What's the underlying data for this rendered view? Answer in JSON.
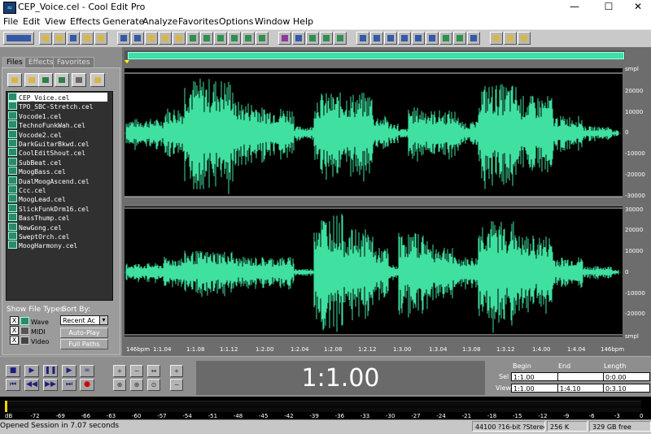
{
  "window": {
    "title": "CEP_Voice.cel - Cool Edit Pro",
    "minimize_glyph": "—",
    "maximize_glyph": "☐",
    "close_glyph": "✕"
  },
  "menu": [
    "File",
    "Edit",
    "View",
    "Effects",
    "Generate",
    "Analyze",
    "Favorites",
    "Options",
    "Window",
    "Help"
  ],
  "panel": {
    "tabs": [
      "Files",
      "Effects",
      "Favorites"
    ],
    "files": [
      "CEP_Voice.cel",
      "TPO_SBC-Stretch.cel",
      "Vocode1.cel",
      "TechnoFunkWah.cel",
      "Vocode2.cel",
      "DarkGuitarBkwd.cel",
      "CoolEditShout.cel",
      "SubBeat.cel",
      "MoogBass.cel",
      "DualMoogAscend.cel",
      "Ccc.cel",
      "MoogLead.cel",
      "SlickFunkDrm16.cel",
      "BassThump.cel",
      "NewGong.cel",
      "SweptOrch.cel",
      "MoogHarmony.cel"
    ],
    "selected_index": 0,
    "show_file_types_label": "Show File Types:",
    "sort_by_label": "Sort By:",
    "file_types": [
      {
        "label": "Wave",
        "checked": true
      },
      {
        "label": "MIDI",
        "checked": true
      },
      {
        "label": "Video",
        "checked": true
      }
    ],
    "check_glyph": "X",
    "sort_value": "Recent Ac",
    "dropdown_glyph": "▾",
    "auto_play_label": "Auto-Play",
    "full_paths_label": "Full Paths"
  },
  "waveform": {
    "ruler_unit": "smpl",
    "ch1_labels": [
      "20000",
      "10000",
      "0",
      "-10000",
      "-20000",
      "-30000"
    ],
    "ch2_labels": [
      "30000",
      "20000",
      "10000",
      "0",
      "-10000",
      "-20000"
    ],
    "time_labels": [
      "146bpm",
      "1:1.04",
      "1:1.08",
      "1:1.12",
      "1:2.00",
      "1:2.04",
      "1:2.08",
      "1:2.12",
      "1:3.00",
      "1:3.04",
      "1:3.08",
      "1:3.12",
      "1:4.00",
      "1:4.04",
      "146bpm"
    ],
    "wave_color": "#3fe0a0",
    "bg_color": "#000000"
  },
  "transport": {
    "time_display": "1:1.00",
    "stop_glyph": "■",
    "play_glyph": "▶",
    "pause_glyph": "❚❚",
    "play_to_end_glyph": "▶",
    "loop_glyph": "∞",
    "goto_start_glyph": "⏮",
    "rewind_glyph": "◀◀",
    "forward_glyph": "▶▶",
    "goto_end_glyph": "⏭",
    "record_glyph": "●"
  },
  "selection": {
    "headers": [
      "Begin",
      "End",
      "Length"
    ],
    "sel_label": "Sel",
    "view_label": "View",
    "sel": [
      "1:1.00",
      "",
      "0:0.00"
    ],
    "view": [
      "1:1.00",
      "1:4.10",
      "0:3.10"
    ]
  },
  "meter": {
    "labels": [
      "dB",
      "-72",
      "-69",
      "-66",
      "-63",
      "-60",
      "-57",
      "-54",
      "-51",
      "-48",
      "-45",
      "-42",
      "-39",
      "-36",
      "-33",
      "-30",
      "-27",
      "-24",
      "-21",
      "-18",
      "-15",
      "-12",
      "-9",
      "-6",
      "-3",
      "0"
    ]
  },
  "status": {
    "message": "Opened Session in 7.07 seconds",
    "format": "44100 ?16-bit ?Stereo",
    "size": "256 K",
    "free": "329 GB free"
  }
}
